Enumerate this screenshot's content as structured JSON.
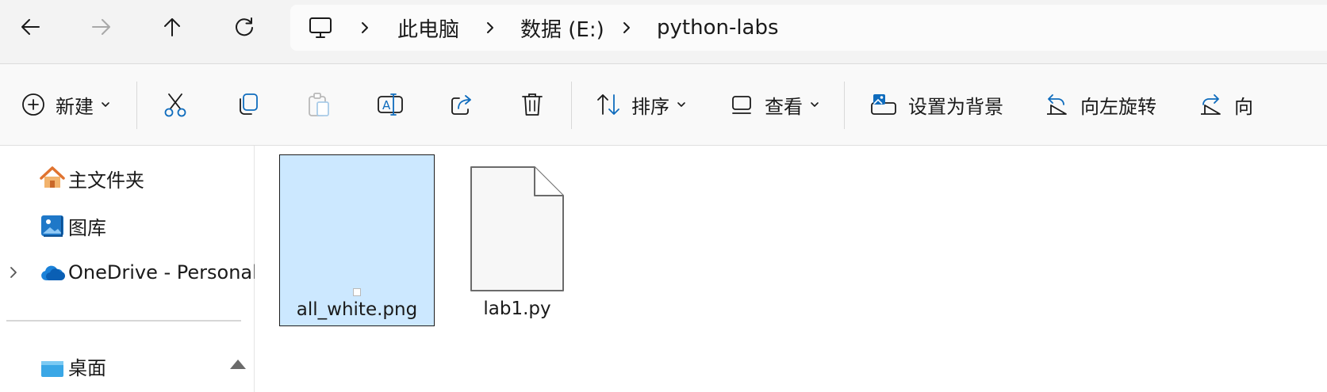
{
  "nav": {
    "back": "back-arrow-icon",
    "forward": "forward-arrow-icon",
    "up": "up-arrow-icon",
    "refresh": "refresh-icon"
  },
  "breadcrumb": {
    "root_icon": "computer-icon",
    "items": [
      "此电脑",
      "数据 (E:)",
      "python-labs"
    ]
  },
  "toolbar": {
    "new_label": "新建",
    "sort_label": "排序",
    "view_label": "查看",
    "set_background_label": "设置为背景",
    "rotate_left_label": "向左旋转",
    "rotate_right_partial_label": "向"
  },
  "sidebar": {
    "items": [
      {
        "label": "主文件夹",
        "icon": "home-icon"
      },
      {
        "label": "图库",
        "icon": "gallery-icon"
      },
      {
        "label": "OneDrive - Personal",
        "icon": "onedrive-cloud-icon"
      },
      {
        "label": "桌面",
        "icon": "desktop-icon"
      }
    ]
  },
  "files": [
    {
      "name": "all_white.png",
      "selected": true
    },
    {
      "name": "lab1.py",
      "selected": false
    }
  ],
  "colors": {
    "accent": "#0f6cbd",
    "selection": "#cce8ff"
  }
}
